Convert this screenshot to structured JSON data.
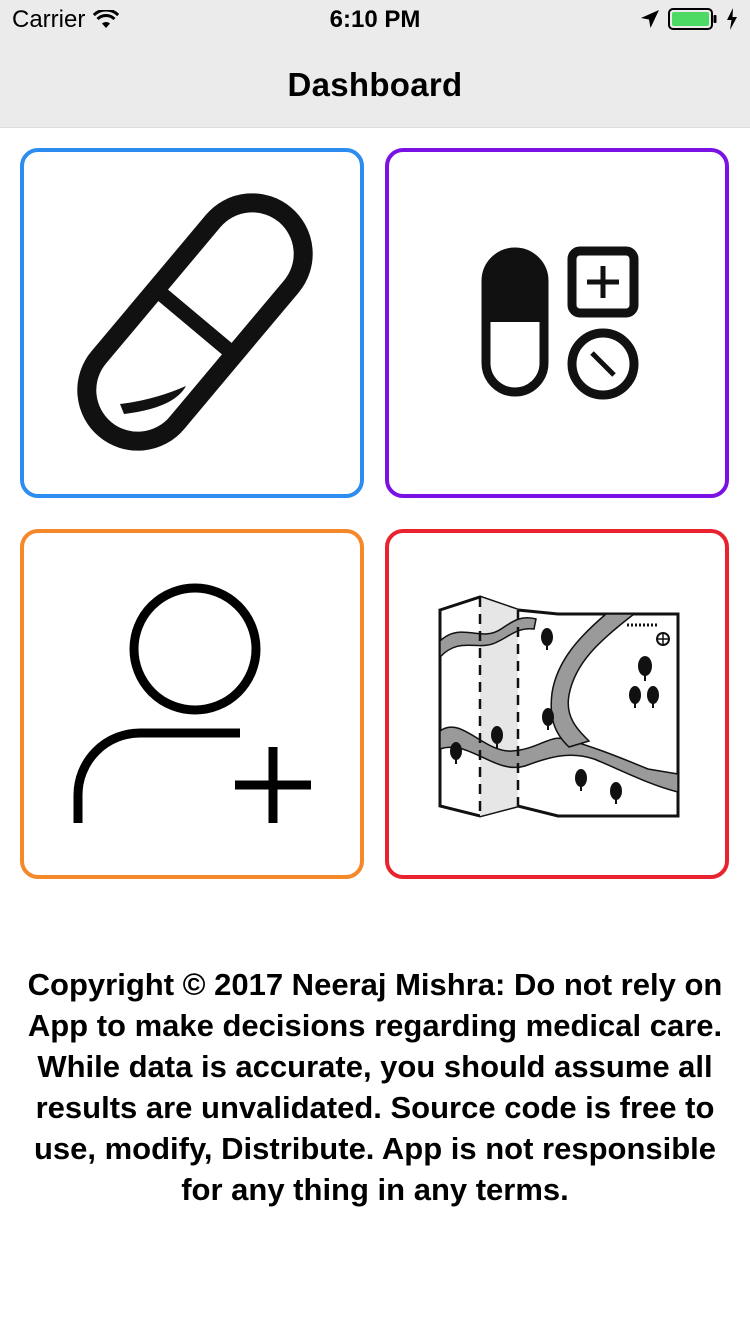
{
  "status_bar": {
    "carrier": "Carrier",
    "time": "6:10 PM",
    "icons": [
      "wifi-icon",
      "location-arrow-icon",
      "battery-icon",
      "charging-bolt-icon"
    ],
    "battery_color": "#4cd964"
  },
  "nav": {
    "title": "Dashboard",
    "background": "#ebebeb"
  },
  "tiles": [
    {
      "icon": "pill-capsule-icon",
      "border_color": "#2d8cf0"
    },
    {
      "icon": "pill-calculator-icon",
      "border_color": "#7a12e6"
    },
    {
      "icon": "add-user-icon",
      "border_color": "#f5892a"
    },
    {
      "icon": "map-icon",
      "border_color": "#e8232f"
    }
  ],
  "disclaimer": "Copyright © 2017 Neeraj Mishra: Do not rely on App to make decisions regarding medical care. While data is accurate, you should assume all results are unvalidated. Source code is free to use, modify, Distribute. App is not responsible for any thing in any terms."
}
